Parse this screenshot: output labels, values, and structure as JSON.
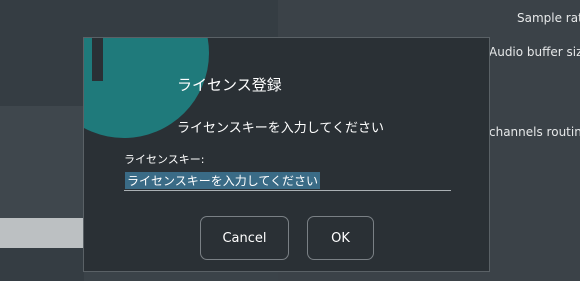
{
  "background": {
    "sample_rate_label": "Sample rat",
    "audio_buffer_label": "Audio buffer siz",
    "channels_routing_label": "channels routin"
  },
  "dialog": {
    "icon": "info-icon",
    "accent_color": "#1f7a7b",
    "title": "ライセンス登録",
    "message": "ライセンスキーを入力してください",
    "field_label": "ライセンスキー:",
    "field_value": "ライセンスキーを入力してください",
    "cancel_label": "Cancel",
    "ok_label": "OK"
  }
}
